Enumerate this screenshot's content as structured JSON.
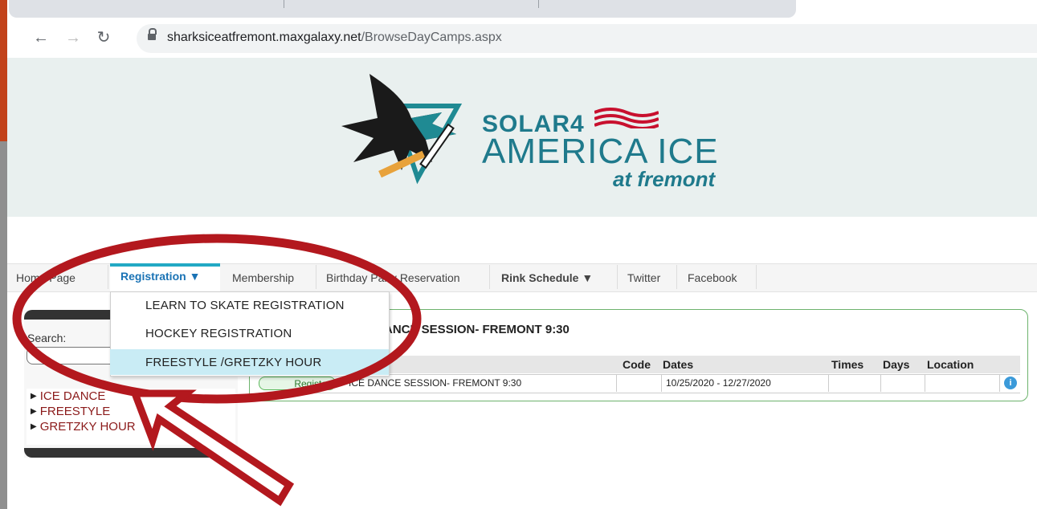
{
  "browser": {
    "url_domain": "sharksiceatfremont.maxgalaxy.net",
    "url_path": "/BrowseDayCamps.aspx"
  },
  "banner": {
    "logo_solar": "SOLAR4",
    "logo_america_ice": "AMERICA ICE",
    "logo_at_fremont": "at fremont"
  },
  "menu": {
    "home": "Home Page",
    "registration": "Registration ▼",
    "membership": "Membership",
    "birthday": "Birthday Party Reservation",
    "rink_schedule": "Rink Schedule ▼",
    "twitter": "Twitter",
    "facebook": "Facebook"
  },
  "dropdown": {
    "items": [
      "LEARN TO SKATE REGISTRATION",
      "HOCKEY REGISTRATION",
      "FREESTYLE /GRETZKY HOUR"
    ],
    "highlighted_index": 2
  },
  "sidebar": {
    "search_label": "Search:",
    "links": [
      "ICE DANCE",
      "FREESTYLE",
      "GRETZKY HOUR"
    ]
  },
  "panel": {
    "title": "ICE DANCE SESSION- FREMONT 9:30",
    "headers": {
      "code": "Code",
      "dates": "Dates",
      "times": "Times",
      "days": "Days",
      "location": "Location"
    },
    "row": {
      "register_label": "Register",
      "name": "ICE DANCE SESSION- FREMONT 9:30",
      "code": "",
      "dates": "10/25/2020 - 12/27/2020",
      "times": "",
      "days": "",
      "location": ""
    }
  },
  "colors": {
    "annotation_red": "#b3181e",
    "accent_teal": "#1f7a8c",
    "menu_active_bar": "#22a9c4"
  }
}
